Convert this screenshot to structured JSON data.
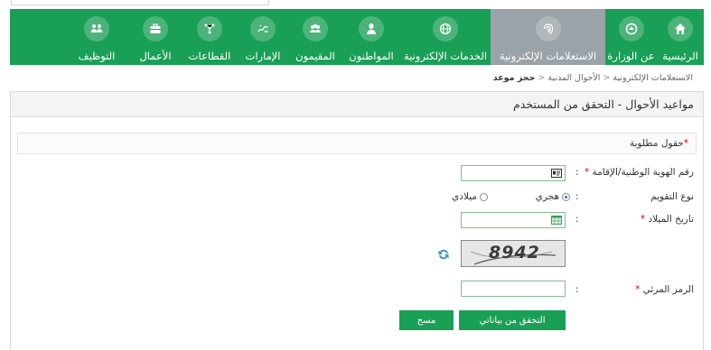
{
  "nav": {
    "items": [
      {
        "label": "الرئيسية",
        "icon": "home-icon",
        "active": false
      },
      {
        "label": "عن الوزارة",
        "icon": "emblem-icon",
        "active": false
      },
      {
        "label": "الاستعلامات الإلكترونية",
        "icon": "fingerprint-icon",
        "active": true
      },
      {
        "label": "الخدمات الإلكترونية",
        "icon": "globe-icon",
        "active": false
      },
      {
        "label": "المواطنون",
        "icon": "person-icon",
        "active": false
      },
      {
        "label": "المقيمون",
        "icon": "group-icon",
        "active": false
      },
      {
        "label": "الإمارات",
        "icon": "calligraphy-icon",
        "active": false
      },
      {
        "label": "القطاعات",
        "icon": "network-icon",
        "active": false
      },
      {
        "label": "الأعمال",
        "icon": "briefcase-icon",
        "active": false
      },
      {
        "label": "التوظيف",
        "icon": "people-icon",
        "active": false
      }
    ],
    "color": "#1a9f57",
    "active_color": "#9aa3a7"
  },
  "breadcrumb": {
    "items": [
      "الاستعلامات الإلكترونية",
      "الأحوال المدنية"
    ],
    "current": "حجز موعد"
  },
  "panel": {
    "title": "مواعيد الأحوال - التحقق من المستخدم"
  },
  "form": {
    "required_note": "حقول مطلوبة",
    "national_id_label": "رقم الهوية الوطنية/الإقامة",
    "national_id_value": "",
    "calendar_type_label": "نوع التقويم",
    "hijri_label": "هجري",
    "gregorian_label": "ميلادي",
    "selected_calendar": "هجري",
    "birth_date_label": "تاريخ الميلاد",
    "birth_date_value": "",
    "captcha_text": "8942",
    "visual_code_label": "الرمز المرئي",
    "visual_code_value": "",
    "verify_button": "التحقق من بياناتي",
    "clear_button": "مسح",
    "colon": ":",
    "star": "*"
  }
}
